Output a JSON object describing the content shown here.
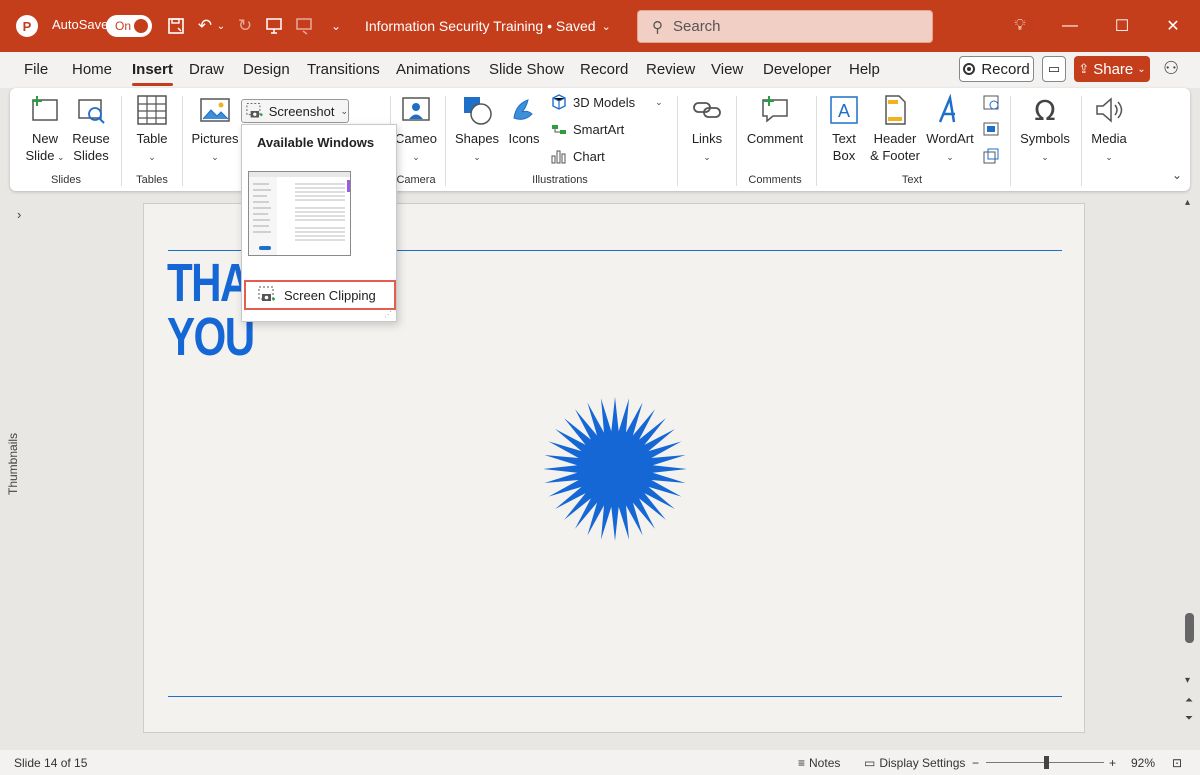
{
  "titlebar": {
    "autosave_label": "AutoSave",
    "autosave_state": "On",
    "doc_title": "Information Security Training • Saved",
    "search_placeholder": "Search",
    "accent": "#c43e1c"
  },
  "tabs": [
    "File",
    "Home",
    "Insert",
    "Draw",
    "Design",
    "Transitions",
    "Animations",
    "Slide Show",
    "Record",
    "Review",
    "View",
    "Developer",
    "Help"
  ],
  "active_tab": "Insert",
  "toprights": {
    "record": "Record",
    "share": "Share"
  },
  "ribbon": {
    "slides": {
      "new_slide_1": "New",
      "new_slide_2": "Slide",
      "reuse_1": "Reuse",
      "reuse_2": "Slides",
      "group": "Slides"
    },
    "tables": {
      "table": "Table",
      "group": "Tables"
    },
    "images": {
      "pictures": "Pictures",
      "screenshot": "Screenshot"
    },
    "camera": {
      "cameo": "Cameo",
      "group": "Camera"
    },
    "illustrations": {
      "shapes": "Shapes",
      "icons": "Icons",
      "models": "3D Models",
      "smartart": "SmartArt",
      "chart": "Chart",
      "group": "Illustrations"
    },
    "links": {
      "links": "Links"
    },
    "comments": {
      "comment": "Comment",
      "group": "Comments"
    },
    "text": {
      "textbox_1": "Text",
      "textbox_2": "Box",
      "header_1": "Header",
      "header_2": "& Footer",
      "wordart": "WordArt",
      "group": "Text"
    },
    "symbols": {
      "symbols": "Symbols"
    },
    "media": {
      "media": "Media"
    }
  },
  "dropdown": {
    "header": "Available Windows",
    "screen_clipping": "Screen Clipping"
  },
  "slide": {
    "thanks_line1": "THA",
    "thanks_line2": "YOU",
    "accent": "#1667d6"
  },
  "thumbnails_label": "Thumbnails",
  "statusbar": {
    "slide_info": "Slide 14 of 15",
    "notes": "Notes",
    "display_settings": "Display Settings",
    "zoom": "92%"
  }
}
